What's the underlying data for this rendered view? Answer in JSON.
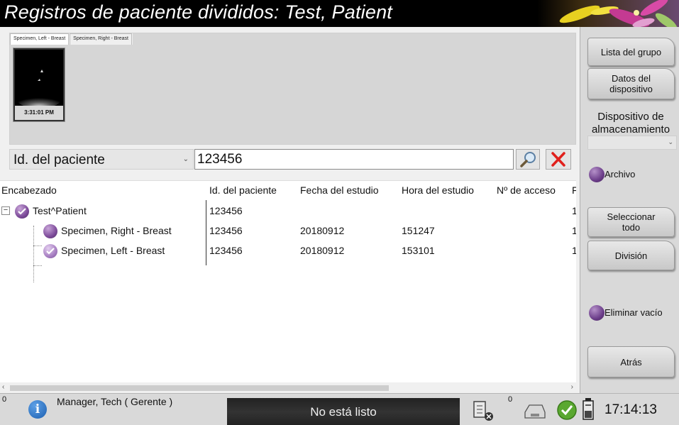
{
  "window": {
    "title": "Registros de paciente divididos: Test, Patient"
  },
  "thumbnails": {
    "tabs": [
      "Specimen, Left - Breast",
      "Specimen, Right - Breast"
    ],
    "items": [
      {
        "time": "3:31:01 PM"
      }
    ]
  },
  "search": {
    "field_selected": "Id. del paciente",
    "value": "123456",
    "search_icon": "magnifier-icon",
    "clear_icon": "red-x-icon"
  },
  "table": {
    "columns": [
      "Encabezado",
      "Id. del paciente",
      "Fecha del estudio",
      "Hora del estudio",
      "Nº de acceso",
      "F"
    ],
    "rows": [
      {
        "heading": "Test^Patient",
        "patient_id": "123456",
        "study_date": "",
        "study_time": "",
        "accession": "",
        "extra": "1",
        "checked": true,
        "expander": "−"
      },
      {
        "heading": "Specimen, Right - Breast",
        "patient_id": "123456",
        "study_date": "20180912",
        "study_time": "151247",
        "accession": "",
        "extra": "1",
        "checked": false
      },
      {
        "heading": "Specimen, Left - Breast",
        "patient_id": "123456",
        "study_date": "20180912",
        "study_time": "153101",
        "accession": "",
        "extra": "1",
        "checked": true
      }
    ]
  },
  "right_panel": {
    "group_list": "Lista del grupo",
    "device_data": "Datos del dispositivo",
    "storage_label": "Dispositivo de almacenamiento",
    "archive": "Archivo",
    "select_all": "Seleccionar todo",
    "split": "División",
    "delete_empty": "Eliminar vacío",
    "back": "Atrás"
  },
  "statusbar": {
    "left_count": "0",
    "user": "Manager, Tech ( Gerente )",
    "status": "No está listo",
    "queue_count": "0",
    "time": "17:14:13"
  },
  "colors": {
    "accent_purple": "#7d4b9a",
    "clear_red": "#e0201c"
  }
}
